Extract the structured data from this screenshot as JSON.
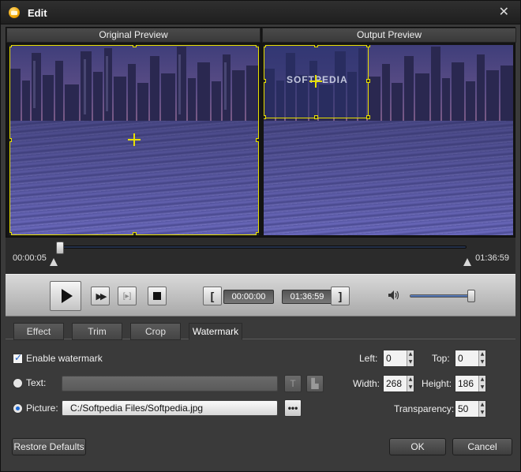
{
  "window": {
    "title": "Edit"
  },
  "preview": {
    "original_label": "Original Preview",
    "output_label": "Output Preview",
    "watermark_overlay_text": "SOFTPEDIA"
  },
  "timeline": {
    "start_time": "00:00:05",
    "end_time": "01:36:59",
    "position_fraction": 0.01
  },
  "controls": {
    "play_label": "play",
    "trim_start_time": "00:00:00",
    "trim_end_time": "01:36:59",
    "bracket_open": "[",
    "bracket_close": "]",
    "volume_fraction": 0.97
  },
  "tabs": [
    {
      "label": "Effect"
    },
    {
      "label": "Trim"
    },
    {
      "label": "Crop"
    },
    {
      "label": "Watermark",
      "active": true
    }
  ],
  "watermark": {
    "enable_label": "Enable watermark",
    "text_label": "Text:",
    "text_value": "",
    "picture_label": "Picture:",
    "picture_path": "C:/Softpedia Files/Softpedia.jpg",
    "browse_label": "•••",
    "left_label": "Left:",
    "left_value": "0",
    "top_label": "Top:",
    "top_value": "0",
    "width_label": "Width:",
    "width_value": "268",
    "height_label": "Height:",
    "height_value": "186",
    "transparency_label": "Transparency:",
    "transparency_value": "50"
  },
  "footer": {
    "restore_label": "Restore Defaults",
    "ok_label": "OK",
    "cancel_label": "Cancel"
  },
  "colors": {
    "selection": "#e8e000",
    "accent_blue": "#1c6ad8"
  }
}
